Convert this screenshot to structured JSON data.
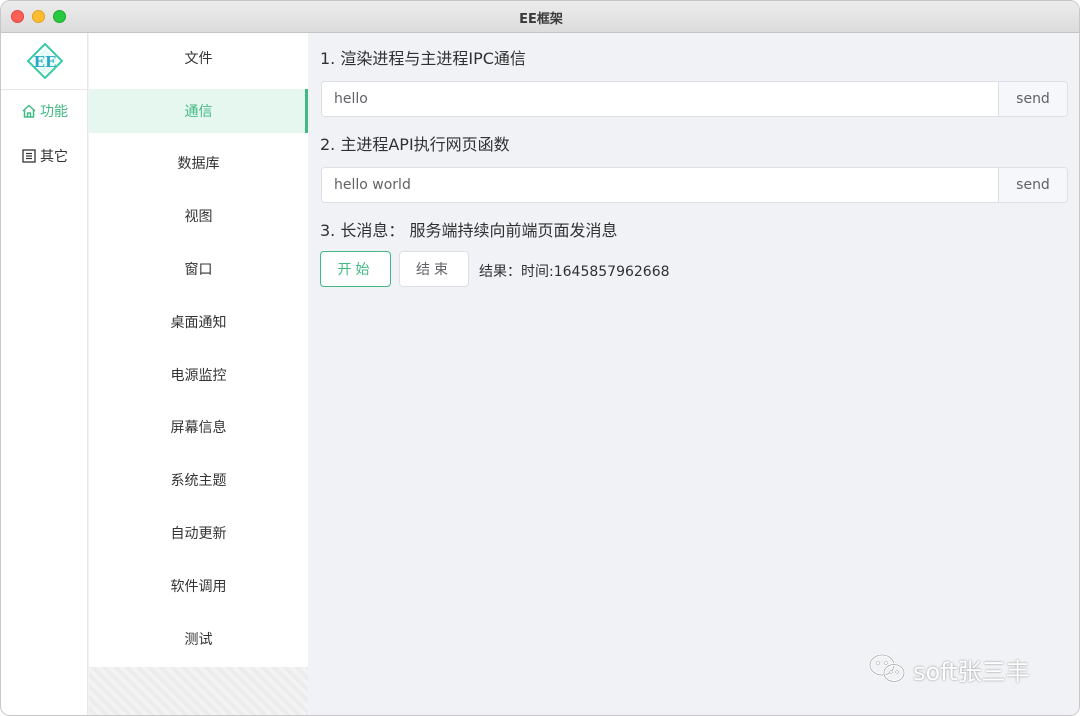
{
  "window": {
    "title": "EE框架"
  },
  "rail": {
    "items": [
      {
        "label": "功能",
        "icon": "home-icon",
        "active": true
      },
      {
        "label": "其它",
        "icon": "list-icon",
        "active": false
      }
    ]
  },
  "menu": {
    "items": [
      {
        "label": "文件"
      },
      {
        "label": "通信",
        "active": true
      },
      {
        "label": "数据库"
      },
      {
        "label": "视图"
      },
      {
        "label": "窗口"
      },
      {
        "label": "桌面通知"
      },
      {
        "label": "电源监控"
      },
      {
        "label": "屏幕信息"
      },
      {
        "label": "系统主题"
      },
      {
        "label": "自动更新"
      },
      {
        "label": "软件调用"
      },
      {
        "label": "测试"
      }
    ]
  },
  "content": {
    "section1": {
      "title": "1. 渲染进程与主进程IPC通信",
      "input_value": "hello",
      "button": "send"
    },
    "section2": {
      "title": "2. 主进程API执行网页函数",
      "input_value": "hello world",
      "button": "send"
    },
    "section3": {
      "title": "3. 长消息： 服务端持续向前端页面发消息",
      "start_button": "开始",
      "stop_button": "结束",
      "result": "结果：时间:1645857962668"
    }
  },
  "watermark": "soft张三丰",
  "colors": {
    "accent": "#42b983",
    "accent_bg": "#e6f7ef",
    "content_bg": "#f0f2f5"
  }
}
